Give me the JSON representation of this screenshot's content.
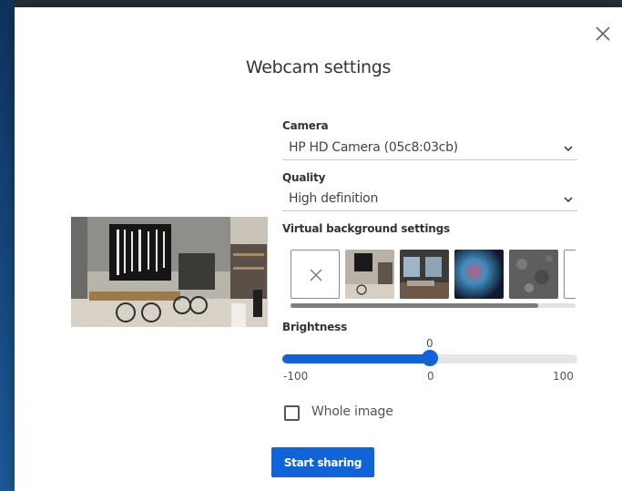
{
  "dialog": {
    "title": "Webcam settings",
    "close_icon": "close-icon"
  },
  "camera": {
    "label": "Camera",
    "value": "HP HD Camera (05c8:03cb)"
  },
  "quality": {
    "label": "Quality",
    "value": "High definition"
  },
  "virtual_background": {
    "label": "Virtual background settings",
    "options": [
      {
        "name": "none",
        "icon": "close-icon"
      },
      {
        "name": "cafe"
      },
      {
        "name": "room"
      },
      {
        "name": "blur-blue"
      },
      {
        "name": "grey-texture"
      },
      {
        "name": "white"
      }
    ],
    "scroll_position": 0.87
  },
  "brightness": {
    "label": "Brightness",
    "value": "0",
    "value_numeric": 0,
    "min": "-100",
    "mid": "0",
    "max": "100",
    "min_numeric": -100,
    "max_numeric": 100
  },
  "whole_image": {
    "label": "Whole image",
    "checked": false
  },
  "start_button": {
    "label": "Start sharing"
  },
  "colors": {
    "accent": "#1164d8",
    "backdrop": "#1a4f8a"
  }
}
